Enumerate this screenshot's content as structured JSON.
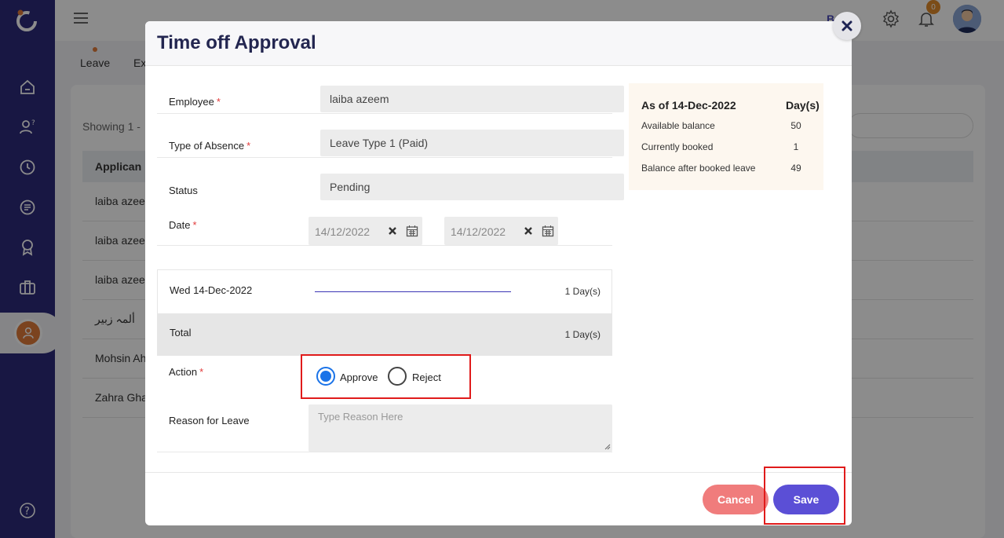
{
  "app": {
    "top_user_text": "B        a",
    "notification_count": "0",
    "subtabs": [
      "Leave",
      "Ex"
    ],
    "showing_text": "Showing 1 - ",
    "table_header": "Applican",
    "table_rows": [
      "laiba azeem",
      "laiba azeem",
      "laiba azeem",
      "ألمہ زبیر",
      "Mohsin Ah",
      "Zahra Gha"
    ]
  },
  "modal": {
    "title": "Time off Approval",
    "fields": {
      "employee_label": "Employee",
      "employee_value": "laiba azeem",
      "absence_label": "Type of Absence",
      "absence_value": "Leave Type 1 (Paid)",
      "status_label": "Status",
      "status_value": "Pending",
      "date_label": "Date",
      "date_from": "14/12/2022",
      "date_to": "14/12/2022",
      "action_label": "Action",
      "reason_label": "Reason for Leave",
      "reason_placeholder": "Type Reason Here",
      "required_mark": "*"
    },
    "days": {
      "day_label": "Wed 14-Dec-2022",
      "day_value": "1 Day(s)",
      "total_label": "Total",
      "total_value": "1 Day(s)"
    },
    "action_options": {
      "approve": "Approve",
      "reject": "Reject",
      "selected": "Approve"
    },
    "balance": {
      "header_left": "As of 14-Dec-2022",
      "header_right": "Day(s)",
      "items": [
        {
          "label": "Available balance",
          "value": "50"
        },
        {
          "label": "Currently booked",
          "value": "1"
        },
        {
          "label": "Balance after booked leave",
          "value": "49"
        }
      ]
    },
    "buttons": {
      "cancel": "Cancel",
      "save": "Save"
    }
  },
  "colors": {
    "sidebar": "#2c2a7a",
    "primary": "#5b4fd6",
    "cancel": "#f07c7c",
    "highlight": "#e01b1b",
    "radio_checked": "#1a73e8"
  }
}
